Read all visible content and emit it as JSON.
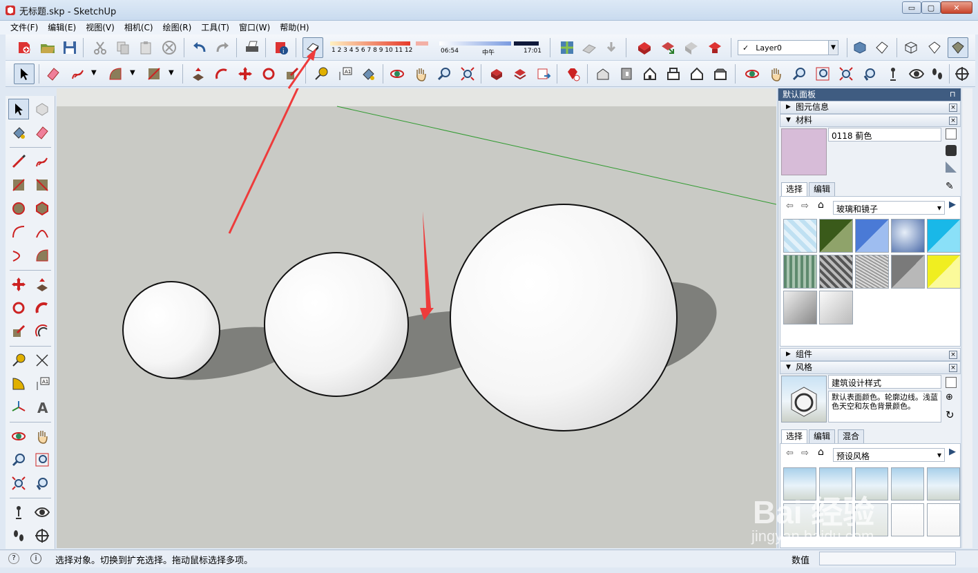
{
  "window": {
    "title": "无标题.skp - SketchUp",
    "minimize": "▭",
    "maximize": "▢",
    "close": "✕"
  },
  "menu": [
    "文件(F)",
    "编辑(E)",
    "视图(V)",
    "相机(C)",
    "绘图(R)",
    "工具(T)",
    "窗口(W)",
    "帮助(H)"
  ],
  "shadow": {
    "months": "1 2 3 4 5 6 7 8 9 10 11 12",
    "time_start": "06:54",
    "time_mid": "中午",
    "time_end": "17:01"
  },
  "layer": {
    "check": "✓",
    "name": "Layer0"
  },
  "panel": {
    "title": "默认面板",
    "pin": "⊓",
    "entity_info": "图元信息",
    "materials": {
      "tray": "材料",
      "name": "0118 蓟色",
      "color": "#d7bcd8",
      "tab_select": "选择",
      "tab_edit": "编辑",
      "library": "玻璃和镜子",
      "dropdown": "▾"
    },
    "components": "组件",
    "styles": {
      "tray": "风格",
      "name": "建筑设计样式",
      "description": "默认表面颜色。轮廓边线。浅蓝色天空和灰色背景颜色。",
      "tab_select": "选择",
      "tab_edit": "编辑",
      "tab_mix": "混合",
      "library": "预设风格"
    }
  },
  "status": {
    "text": "选择对象。切换到扩充选择。拖动鼠标选择多项。",
    "vcb_label": "数值",
    "vcb_value": ""
  },
  "watermark": {
    "main": "Bai 经验",
    "sub": "jingyan.baidu.com"
  }
}
